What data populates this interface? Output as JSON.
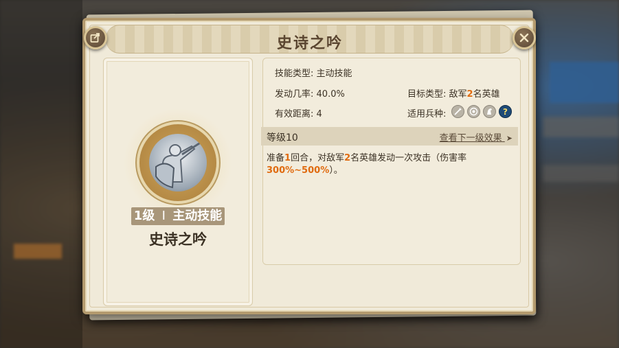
{
  "dialog": {
    "title": "史诗之吟",
    "share_icon": "share-icon",
    "close_icon": "close-icon"
  },
  "skill": {
    "level_number": "1级",
    "divider": "I",
    "type_short": "主动技能",
    "name": "史诗之吟",
    "icon": "warrior-shield-icon"
  },
  "details": {
    "skill_type_label": "技能类型:",
    "skill_type_value": "主动技能",
    "trigger_rate_label": "发动几率:",
    "trigger_rate_value": "40.0%",
    "target_type_label": "目标类型:",
    "target_prefix": "敌军",
    "target_count": "2",
    "target_suffix": "名英雄",
    "range_label": "有效距离:",
    "range_value": "4",
    "troop_types_label": "适用兵种:",
    "troop_icons": [
      "sword-icon",
      "target-icon",
      "horse-icon",
      "question-icon"
    ]
  },
  "level_section": {
    "label": "等级10",
    "next_link": "查看下一级效果",
    "next_arrow": "➤"
  },
  "description": {
    "part1": "准备",
    "num1": "1",
    "part2": "回合，对敌军",
    "num2": "2",
    "part3": "名英雄发动一次攻击（伤害率",
    "damage": "300%~500%",
    "part4": "）。"
  },
  "colors": {
    "accent_orange": "#e06b10",
    "title_brown": "#5a4530",
    "parchment": "#f0ead9"
  }
}
